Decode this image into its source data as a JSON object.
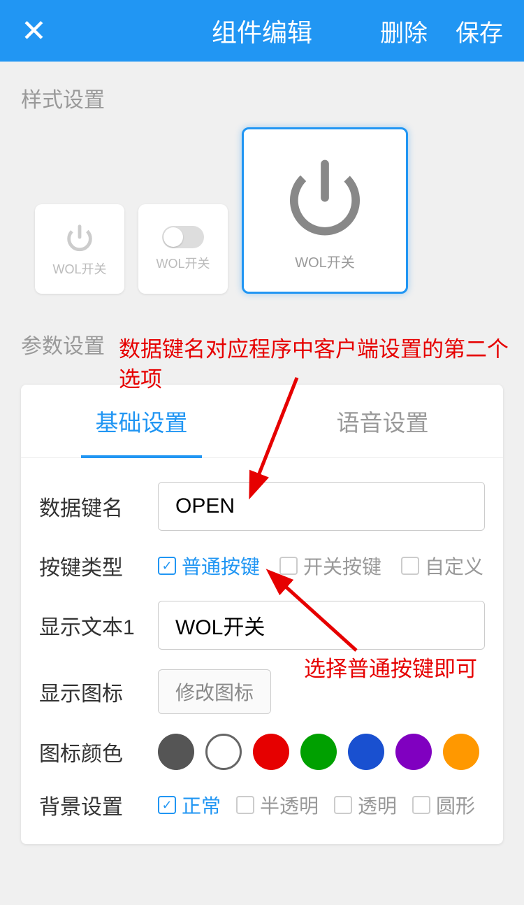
{
  "header": {
    "title": "组件编辑",
    "delete": "删除",
    "save": "保存"
  },
  "style_section": {
    "label": "样式设置",
    "card1_label": "WOL开关",
    "card2_label": "WOL开关",
    "card3_label": "WOL开关"
  },
  "param_section": {
    "label": "参数设置"
  },
  "annotations": {
    "top": "数据键名对应程序中客户端设置的第二个选项",
    "right": "选择普通按键即可"
  },
  "tabs": {
    "basic": "基础设置",
    "voice": "语音设置"
  },
  "form": {
    "data_key_label": "数据键名",
    "data_key_value": "OPEN",
    "key_type_label": "按键类型",
    "key_type_options": {
      "normal": "普通按键",
      "switch": "开关按键",
      "custom": "自定义"
    },
    "display_text_label": "显示文本1",
    "display_text_value": "WOL开关",
    "display_icon_label": "显示图标",
    "change_icon_btn": "修改图标",
    "icon_color_label": "图标颜色",
    "bg_setting_label": "背景设置",
    "bg_options": {
      "normal": "正常",
      "translucent": "半透明",
      "transparent": "透明",
      "circle": "圆形"
    }
  },
  "colors": {
    "gray": "#555555",
    "white": "#ffffff",
    "red": "#e60000",
    "green": "#00a000",
    "blue": "#1950d0",
    "purple": "#8000c0",
    "orange": "#ff9800"
  }
}
